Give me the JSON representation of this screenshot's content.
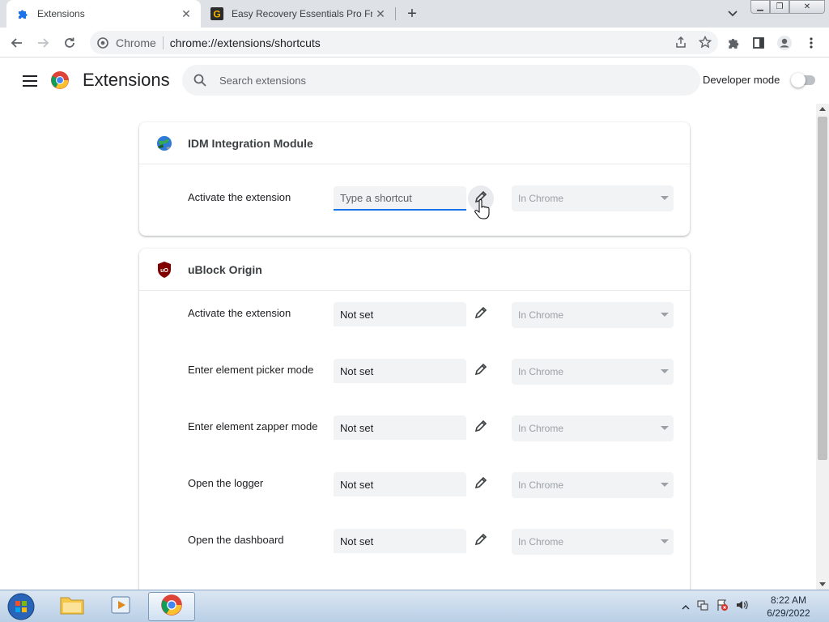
{
  "tabs": [
    {
      "title": "Extensions",
      "icon": "puzzle-icon",
      "active": true
    },
    {
      "title": "Easy Recovery Essentials Pro Free",
      "icon": "g-logo-icon",
      "active": false
    }
  ],
  "toolbar": {
    "omnibox_scheme": "Chrome",
    "omnibox_url": "chrome://extensions/shortcuts"
  },
  "header": {
    "title": "Extensions",
    "search_placeholder": "Search extensions",
    "developer_mode_label": "Developer mode",
    "developer_mode_on": false
  },
  "extensions": [
    {
      "name": "IDM Integration Module",
      "icon": "idm-globe-icon",
      "commands": [
        {
          "label": "Activate the extension",
          "shortcut": "Type a shortcut",
          "editing": true,
          "scope": "In Chrome"
        }
      ]
    },
    {
      "name": "uBlock Origin",
      "icon": "ublock-shield-icon",
      "commands": [
        {
          "label": "Activate the extension",
          "shortcut": "Not set",
          "editing": false,
          "scope": "In Chrome"
        },
        {
          "label": "Enter element picker mode",
          "shortcut": "Not set",
          "editing": false,
          "scope": "In Chrome"
        },
        {
          "label": "Enter element zapper mode",
          "shortcut": "Not set",
          "editing": false,
          "scope": "In Chrome"
        },
        {
          "label": "Open the logger",
          "shortcut": "Not set",
          "editing": false,
          "scope": "In Chrome"
        },
        {
          "label": "Open the dashboard",
          "shortcut": "Not set",
          "editing": false,
          "scope": "In Chrome"
        }
      ]
    }
  ],
  "taskbar": {
    "time": "8:22 AM",
    "date": "6/29/2022"
  },
  "colors": {
    "accent": "#1a73e8",
    "tabstrip": "#dee1e6",
    "field_bg": "#f1f3f4"
  }
}
